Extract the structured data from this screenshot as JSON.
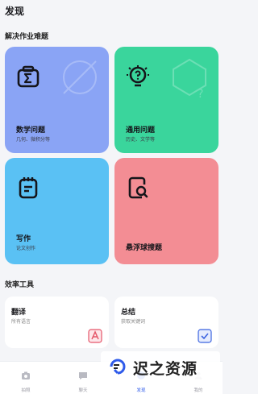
{
  "header": {
    "title": "发现"
  },
  "solve_section": {
    "title": "解决作业难题",
    "cards": [
      {
        "title": "数学问题",
        "subtitle": "几何、微积分等",
        "icon": "sigma-camera-icon"
      },
      {
        "title": "通用问题",
        "subtitle": "历史、文学等",
        "icon": "lightbulb-question-icon"
      },
      {
        "title": "写作",
        "subtitle": "论文创作",
        "icon": "notepad-icon"
      },
      {
        "title": "悬浮球搜题",
        "subtitle": "",
        "icon": "search-document-icon"
      }
    ]
  },
  "tools_section": {
    "title": "效率工具",
    "tools": [
      {
        "title": "翻译",
        "subtitle": "所有语言",
        "icon": "translate-icon"
      },
      {
        "title": "总结",
        "subtitle": "获取关键词",
        "icon": "summary-check-icon"
      }
    ]
  },
  "tabbar": {
    "items": [
      {
        "label": "拍照",
        "icon": "camera-icon"
      },
      {
        "label": "聊天",
        "icon": "chat-icon"
      },
      {
        "label": "发现",
        "icon": "discover-icon"
      },
      {
        "label": "我的",
        "icon": "profile-icon"
      }
    ],
    "active_index": 2
  },
  "watermark": {
    "text": "迟之资源"
  },
  "colors": {
    "math_card": "#8aa4f5",
    "general_card": "#3ad59c",
    "writing_card": "#5ac1f4",
    "float_card": "#f38d94",
    "accent": "#2f5bea"
  }
}
